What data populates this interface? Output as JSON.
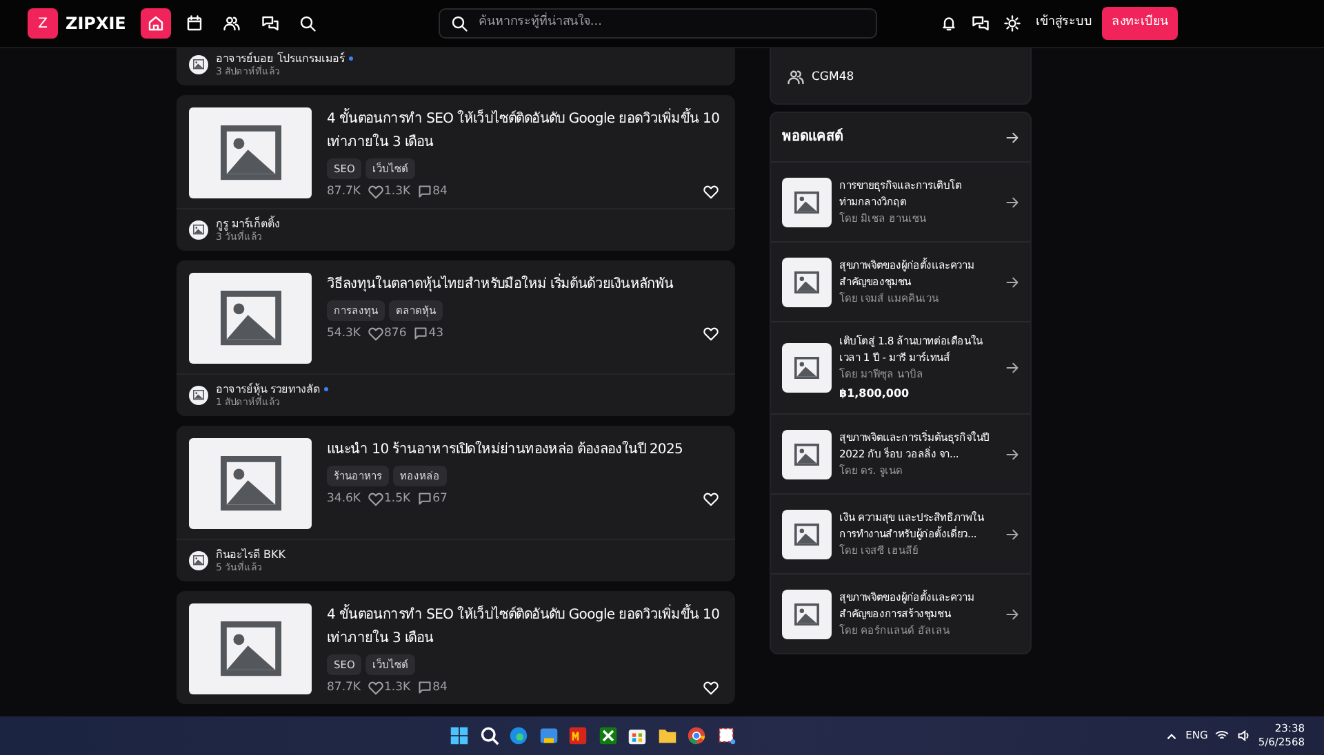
{
  "navbar": {
    "logo_letter": "Z",
    "brand": "ZIPXIE",
    "nav_icons": [
      {
        "kind": "home",
        "selected": true
      },
      {
        "kind": "calendar",
        "selected": false
      },
      {
        "kind": "people",
        "selected": false
      },
      {
        "kind": "chat",
        "selected": false
      },
      {
        "kind": "search",
        "selected": false
      }
    ],
    "search": {
      "placeholder": "ค้นหากระทู้ที่น่าสนใจ..."
    },
    "login": "เข้าสู่ระบบ",
    "register": "ลงทะเบียน"
  },
  "feed": [
    {
      "author": "อาจารย์บอย โปรแกรมเมอร์",
      "verified": true,
      "time": "3 สัปดาห์ที่แล้ว"
    },
    {
      "title": "4 ขั้นตอนการทำ SEO ให้เว็บไซต์ติดอันดับ Google ยอดวิวเพิ่มขึ้น 10 เท่าภายใน 3 เดือน",
      "tags": [
        "SEO",
        "เว็บไซต์"
      ],
      "views": "87.7K",
      "likes": "1.3K",
      "comments": "84",
      "author": "กูรู มาร์เก็ตติ้ง",
      "verified": false,
      "time": "3 วันที่แล้ว"
    },
    {
      "title": "วิธีลงทุนในตลาดหุ้นไทยสำหรับมือใหม่ เริ่มต้นด้วยเงินหลักพัน",
      "tags": [
        "การลงทุน",
        "ตลาดหุ้น"
      ],
      "views": "54.3K",
      "likes": "876",
      "comments": "43",
      "author": "อาจารย์หุ้น รวยทางลัด",
      "verified": true,
      "time": "1 สัปดาห์ที่แล้ว"
    },
    {
      "title": "แนะนำ 10 ร้านอาหารเปิดใหม่ย่านทองหล่อ ต้องลองในปี 2025",
      "tags": [
        "ร้านอาหาร",
        "ทองหล่อ"
      ],
      "views": "34.6K",
      "likes": "1.5K",
      "comments": "67",
      "author": "กินอะไรดี BKK",
      "verified": false,
      "time": "5 วันที่แล้ว"
    },
    {
      "title": "4 ขั้นตอนการทำ SEO ให้เว็บไซต์ติดอันดับ Google ยอดวิวเพิ่มขึ้น 10 เท่าภายใน 3 เดือน",
      "tags": [
        "SEO",
        "เว็บไซต์"
      ],
      "views": "87.7K",
      "likes": "1.3K",
      "comments": "84"
    }
  ],
  "community": {
    "name": "CGM48"
  },
  "podcasts": {
    "title": "พอดแคสต์",
    "items": [
      {
        "title": "การขายธุรกิจและการเติบโตท่ามกลางวิกฤต",
        "host": "โดย มิเชล ฮานเซน"
      },
      {
        "title": "สุขภาพจิตของผู้ก่อตั้งและความสำคัญของชุมชน",
        "host": "โดย เจมส์ แมคคินเวน"
      },
      {
        "title": "เติบโตสู่ 1.8 ล้านบาทต่อเดือนในเวลา 1 ปี - มารี มาร์เทนส์",
        "host": "โดย มาฟีซุล นาบิล",
        "price": "฿1,800,000"
      },
      {
        "title": "สุขภาพจิตและการเริ่มต้นธุรกิจในปี 2022 กับ ร็อบ วอลลิ่ง จา...",
        "host": "โดย ดร. จูเนด"
      },
      {
        "title": "เงิน ความสุข และประสิทธิภาพในการทำงานสำหรับผู้ก่อตั้งเดี่ยว...",
        "host": "โดย เจสซี เฮนลีย์"
      },
      {
        "title": "สุขภาพจิตของผู้ก่อตั้งและความสำคัญของการสร้างชุมชน",
        "host": "โดย คอร์กแลนด์ อัลเลน"
      }
    ]
  },
  "taskbar": {
    "language": "ENG",
    "time": "23:38",
    "date": "5/6/2568"
  }
}
